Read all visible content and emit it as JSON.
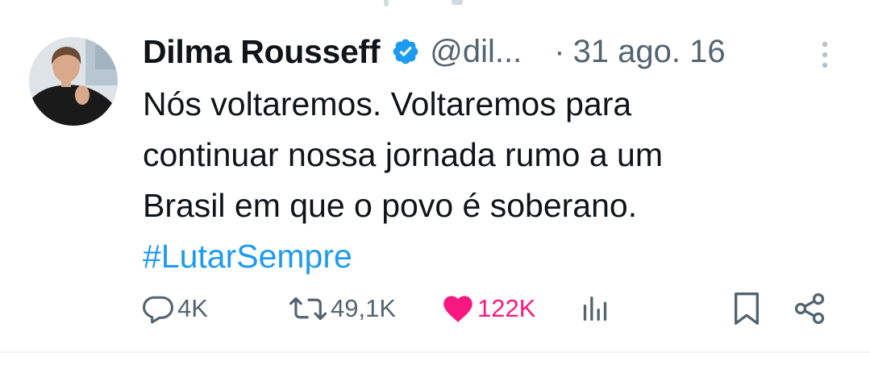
{
  "tweet": {
    "author_name": "Dilma Rousseff",
    "handle": "@dil...",
    "separator": "·",
    "date": "31 ago. 16",
    "text_lines": [
      "Nós voltaremos. Voltaremos para",
      "continuar nossa jornada rumo a um",
      "Brasil em que o povo é soberano."
    ],
    "hashtag": "#LutarSempre",
    "verified": true
  },
  "actions": {
    "replies": "4K",
    "retweets": "49,1K",
    "likes": "122K",
    "liked": true
  },
  "colors": {
    "text": "#0f1419",
    "secondary": "#536471",
    "link": "#1d9bf0",
    "like": "#f91880",
    "verified": "#1d9bf0"
  },
  "icons": {
    "reply": "speech-bubble-icon",
    "retweet": "retweet-arrows-icon",
    "like": "heart-filled-icon",
    "views": "bar-chart-icon",
    "bookmark": "bookmark-icon",
    "share": "share-icon",
    "more": "vertical-ellipsis-icon"
  }
}
